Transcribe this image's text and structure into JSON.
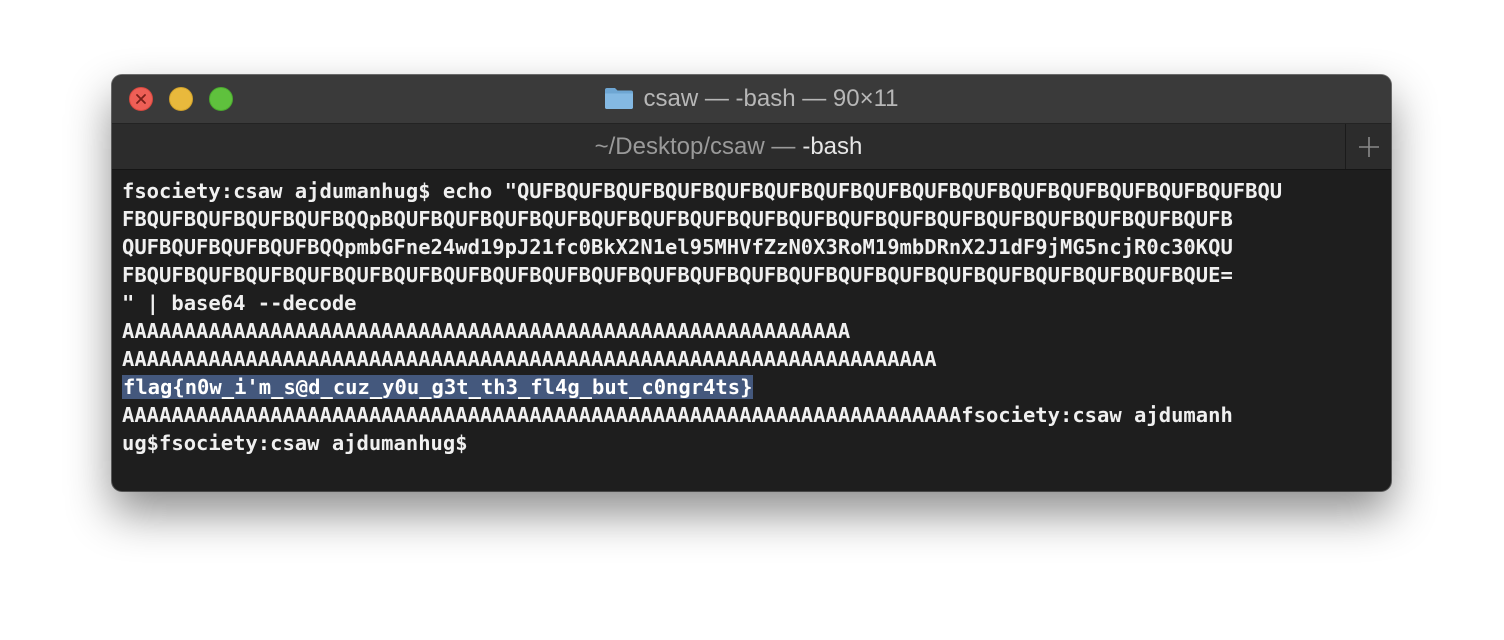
{
  "window": {
    "title": "csaw — -bash — 90×11"
  },
  "tab": {
    "path": "~/Desktop/csaw —",
    "process": "-bash"
  },
  "terminal": {
    "lines": [
      "fsociety:csaw ajdumanhug$ echo \"QUFBQUFBQUFBQUFBQUFBQUFBQUFBQUFBQUFBQUFBQUFBQUFBQUFBQUFBQUFBQU",
      "FBQUFBQUFBQUFBQUFBQQpBQUFBQUFBQUFBQUFBQUFBQUFBQUFBQUFBQUFBQUFBQUFBQUFBQUFBQUFBQUFBQUFBQUFB",
      "QUFBQUFBQUFBQUFBQQpmbGFne24wd19pJ21fc0BkX2N1el95MHVfZzN0X3RoM19mbDRnX2J1dF9jMG5ncjR0c30KQU",
      "FBQUFBQUFBQUFBQUFBQUFBQUFBQUFBQUFBQUFBQUFBQUFBQUFBQUFBQUFBQUFBQUFBQUFBQUFBQUFBQUFBQUFBQUE=",
      "\" | base64 --decode",
      "AAAAAAAAAAAAAAAAAAAAAAAAAAAAAAAAAAAAAAAAAAAAAAAAAAAAAAAAAAA",
      "AAAAAAAAAAAAAAAAAAAAAAAAAAAAAAAAAAAAAAAAAAAAAAAAAAAAAAAAAAAAAAAAAA"
    ],
    "selected_line": "flag{n0w_i'm_s@d_cuz_y0u_g3t_th3_fl4g_but_c0ngr4ts}",
    "tail_lines": [
      "AAAAAAAAAAAAAAAAAAAAAAAAAAAAAAAAAAAAAAAAAAAAAAAAAAAAAAAAAAAAAAAAAAAAfsociety:csaw ajdumanh",
      "ug$fsociety:csaw ajdumanhug$"
    ]
  },
  "icons": {
    "folder": "folder-icon",
    "close": "close-icon",
    "new_tab": "plus-icon"
  },
  "colors": {
    "close": "#ee5f56",
    "minimize": "#e9b93c",
    "zoom": "#5fc13d",
    "selection": "#44587d",
    "terminal_bg": "#1e1e1e"
  }
}
